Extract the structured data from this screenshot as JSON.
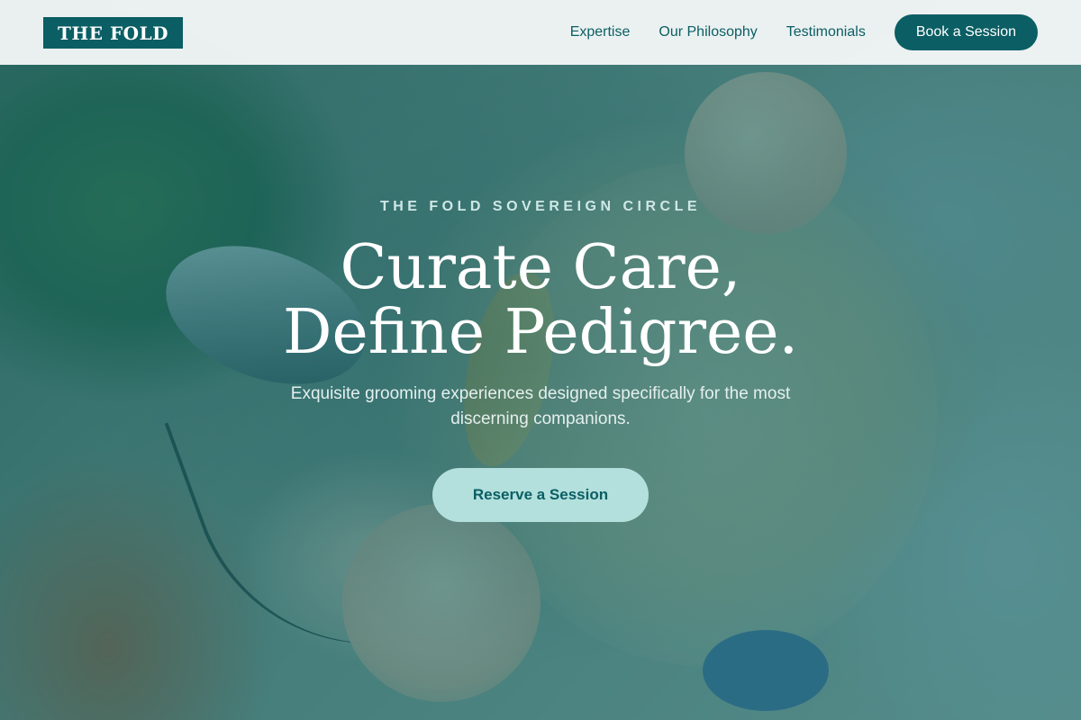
{
  "brand": {
    "logo_text": "THE FOLD"
  },
  "nav": {
    "links": [
      {
        "label": "Expertise"
      },
      {
        "label": "Our Philosophy"
      },
      {
        "label": "Testimonials"
      }
    ],
    "cta_label": "Book a Session"
  },
  "hero": {
    "eyebrow": "THE FOLD SOVEREIGN CIRCLE",
    "headline_line1": "Curate Care,",
    "headline_line2": "Define Pedigree.",
    "subtext": "Exquisite grooming experiences designed specifically for the most discerning companions.",
    "cta_label": "Reserve a Session"
  },
  "colors": {
    "brand_teal": "#0a5e64",
    "header_bg": "#f3f6f6",
    "cta_mint": "#b3e0dc",
    "overlay_teal": "#136e70"
  }
}
